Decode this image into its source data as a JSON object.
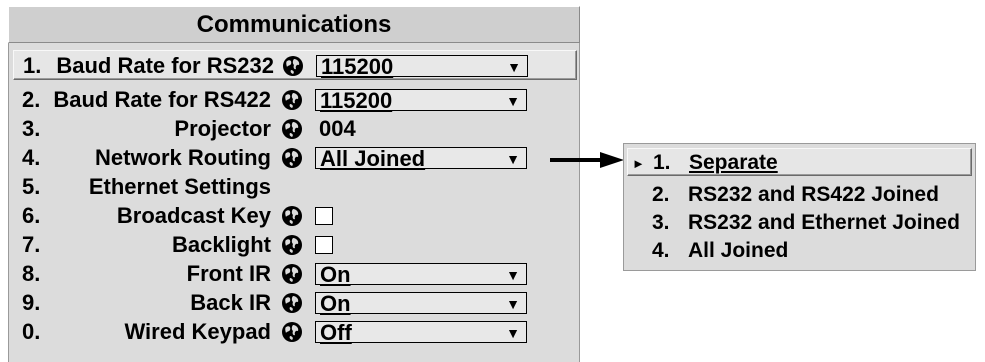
{
  "panel": {
    "title": "Communications",
    "rows": [
      {
        "num": "1.",
        "label": "Baud Rate for RS232",
        "icon": "globe-icon",
        "control": "dropdown",
        "value": "115200",
        "selected": true
      },
      {
        "num": "2.",
        "label": "Baud Rate for RS422",
        "icon": "globe-icon",
        "control": "dropdown",
        "value": "115200"
      },
      {
        "num": "3.",
        "label": "Projector",
        "icon": "globe-icon",
        "control": "text",
        "value": "004"
      },
      {
        "num": "4.",
        "label": "Network Routing",
        "icon": "globe-icon",
        "control": "dropdown",
        "value": "All Joined"
      },
      {
        "num": "5.",
        "label": "Ethernet Settings",
        "control": "none"
      },
      {
        "num": "6.",
        "label": "Broadcast Key",
        "icon": "globe-icon",
        "control": "checkbox",
        "checked": false
      },
      {
        "num": "7.",
        "label": "Backlight",
        "icon": "globe-icon",
        "control": "checkbox",
        "checked": false
      },
      {
        "num": "8.",
        "label": "Front IR",
        "icon": "globe-icon",
        "control": "dropdown",
        "value": "On"
      },
      {
        "num": "9.",
        "label": "Back IR",
        "icon": "globe-icon",
        "control": "dropdown",
        "value": "On"
      },
      {
        "num": "0.",
        "label": "Wired Keypad",
        "icon": "globe-icon",
        "control": "dropdown",
        "value": "Off"
      }
    ]
  },
  "dropdown_arrow": "▼",
  "popup": {
    "pointer": "►",
    "items": [
      {
        "num": "1.",
        "label": "Separate",
        "selected": true
      },
      {
        "num": "2.",
        "label": "RS232 and RS422 Joined"
      },
      {
        "num": "3.",
        "label": "RS232 and Ethernet Joined"
      },
      {
        "num": "4.",
        "label": "All Joined"
      }
    ]
  }
}
